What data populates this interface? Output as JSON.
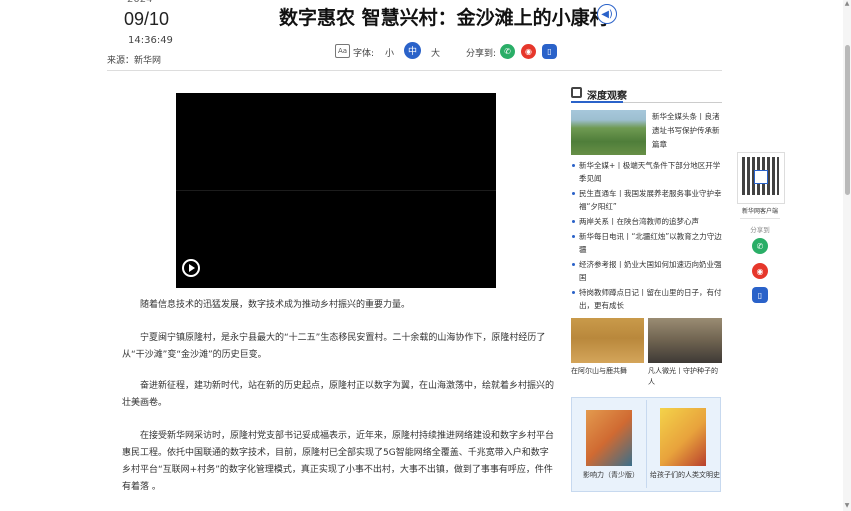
{
  "header": {
    "year": "2024",
    "date": "09/10",
    "time": "14:36:49",
    "source": "来源：新华网",
    "title": "数字惠农 智慧兴村：金沙滩上的小康村",
    "font_icon": "Aa",
    "font_label": "字体:",
    "font_small": "小",
    "font_medium": "中",
    "font_large": "大",
    "share_label": "分享到:"
  },
  "icons": {
    "speaker": "speaker-icon",
    "wechat": "wechat-icon",
    "weibo": "weibo-icon",
    "mobile": "mobile-icon",
    "play": "play-icon"
  },
  "colors": {
    "accent": "#2a62c9",
    "wechat": "#2aae67",
    "weibo": "#e6372b"
  },
  "article": {
    "paragraphs": [
      "随着信息技术的迅猛发展，数字技术成为推动乡村振兴的重要力量。",
      "宁夏闽宁镇原隆村，是永宁县最大的“十二五”生态移民安置村。二十余载的山海协作下，原隆村经历了从“干沙滩”变“金沙滩”的历史巨变。",
      "奋进新征程，建功新时代，站在新的历史起点，原隆村正以数字为翼，在山海激荡中，绘就着乡村振兴的壮美画卷。",
      "在接受新华网采访时，原隆村党支部书记妥成福表示，近年来，原隆村持续推进网络建设和数字乡村平台惠民工程。依托中国联通的数字技术，目前，原隆村已全部实现了5G智能网络全覆盖、千兆宽带入户和数字乡村平台“互联网+村务”的数字化管理模式，真正实现了小事不出村，大事不出镇，做到了事事有呼应，件件有着落 。"
    ]
  },
  "sidebar": {
    "title": "深度观察",
    "featured": "新华全媒头条丨良渚遗址书写保护传承新篇章",
    "news": [
      "新华全媒+丨极端天气条件下部分地区开学季见闻",
      "民生直通车丨我国发展养老服务事业守护幸福“夕阳红”",
      "两岸关系丨在陕台湾教师的追梦心声",
      "新华每日电讯丨“北疆红烛”以教育之力守边疆",
      "经济参考报丨奶业大国如何加速迈向奶业强国",
      "特岗教师蹲点日记丨留在山里的日子，有付出，更有成长"
    ],
    "pic1_caption": "在阿尔山与鹿共舞",
    "pic2_caption": "凡人微光丨守护种子的人",
    "book1_caption": "影响力（青少版）",
    "book2_caption": "给孩子们的人类文明史"
  },
  "float_panel": {
    "qr_caption": "新华网客户端",
    "share_label": "分享到"
  }
}
